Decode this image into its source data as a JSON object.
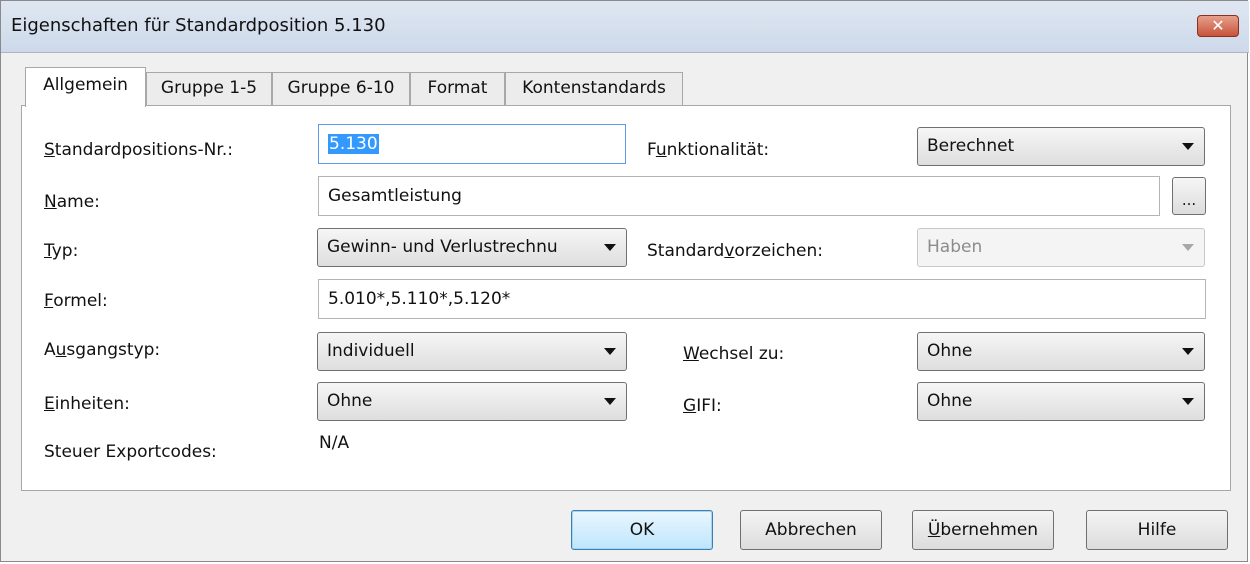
{
  "window": {
    "title": "Eigenschaften für Standardposition 5.130",
    "close_glyph": "✕"
  },
  "tabs": [
    {
      "label": "Allgemein",
      "active": true
    },
    {
      "label": "Gruppe 1-5",
      "active": false
    },
    {
      "label": "Gruppe 6-10",
      "active": false
    },
    {
      "label": "Format",
      "active": false
    },
    {
      "label": "Kontenstandards",
      "active": false
    }
  ],
  "form": {
    "standard_nr": {
      "label": "Standardpositions-Nr.:",
      "accel": "S",
      "label_rest": "tandardpositions-Nr.:",
      "value": "5.130"
    },
    "funktionalitaet": {
      "label": "Funktionalität:",
      "pre": "F",
      "accel": "u",
      "rest": "nktionalität:",
      "value": "Berechnet"
    },
    "name": {
      "label": "Name:",
      "accel": "N",
      "label_rest": "ame:",
      "value": "Gesamtleistung",
      "browse_label": "..."
    },
    "typ": {
      "label": "Typ:",
      "accel": "T",
      "label_rest": "yp:",
      "value": "Gewinn- und Verlustrechnu"
    },
    "standardvorzeichen": {
      "label": "Standardvorzeichen:",
      "pre": "Standard",
      "accel": "v",
      "rest": "orzeichen:",
      "value": "Haben",
      "disabled": true
    },
    "formel": {
      "label": "Formel:",
      "accel": "F",
      "label_rest": "ormel:",
      "value": "5.010*,5.110*,5.120*"
    },
    "ausgangstyp": {
      "label": "Ausgangstyp:",
      "pre": "A",
      "accel": "u",
      "rest": "sgangstyp:",
      "value": "Individuell"
    },
    "wechsel_zu": {
      "label": "Wechsel zu:",
      "accel": "W",
      "label_rest": "echsel zu:",
      "value": "Ohne"
    },
    "einheiten": {
      "label": "Einheiten:",
      "accel": "E",
      "label_rest": "inheiten:",
      "value": "Ohne"
    },
    "gifi": {
      "label": "GIFI:",
      "accel": "G",
      "label_rest": "IFI:",
      "value": "Ohne"
    },
    "steuer_exportcodes": {
      "label": "Steuer Exportcodes:",
      "value": "N/A"
    }
  },
  "buttons": {
    "ok": "OK",
    "abbrechen": "Abbrechen",
    "uebernehmen": {
      "accel": "Ü",
      "rest": "bernehmen"
    },
    "hilfe": "Hilfe"
  },
  "colors": {
    "selection": "#3399ff",
    "default_button_border": "#3c7fb1",
    "close_button": "#c7533a"
  }
}
